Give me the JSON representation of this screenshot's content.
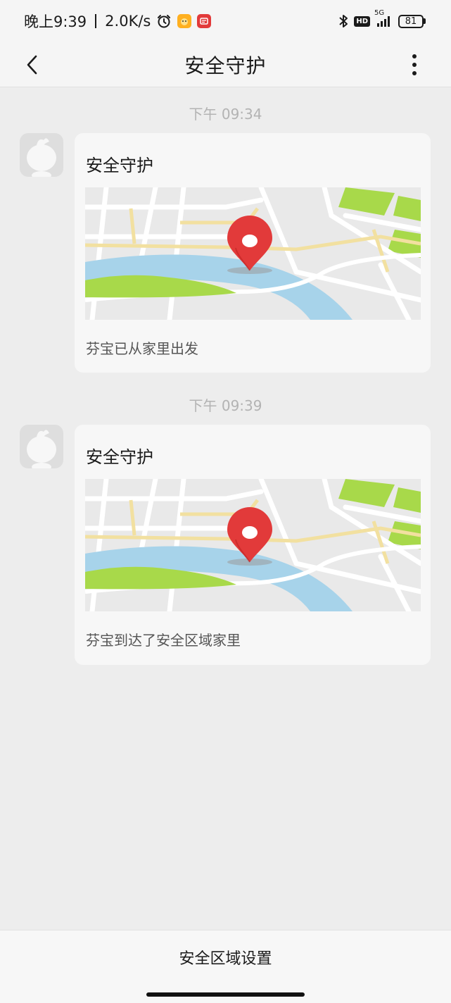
{
  "status_bar": {
    "time": "晚上9:39",
    "network_speed": "2.0K/s",
    "alarm_icon": "alarm-clock-icon",
    "app_icons": [
      "orange-app-icon",
      "news-app-icon"
    ],
    "bluetooth_icon": "bluetooth-icon",
    "hd_label": "HD",
    "signal_label": "5G",
    "battery_level": "81"
  },
  "nav": {
    "title": "安全守护",
    "back_icon": "chevron-left-icon",
    "more_icon": "more-vertical-icon"
  },
  "messages": [
    {
      "time": "下午 09:34",
      "title": "安全守护",
      "text": "芬宝已从家里出发"
    },
    {
      "time": "下午 09:39",
      "title": "安全守护",
      "text": "芬宝到达了安全区域家里"
    }
  ],
  "bottom": {
    "action_label": "安全区域设置"
  },
  "colors": {
    "background": "#ededed",
    "card": "#f7f7f7",
    "pin": "#e23a3a",
    "water": "#a7d3ea",
    "park": "#a8d94a",
    "road_yellow": "#f2e0a0"
  }
}
